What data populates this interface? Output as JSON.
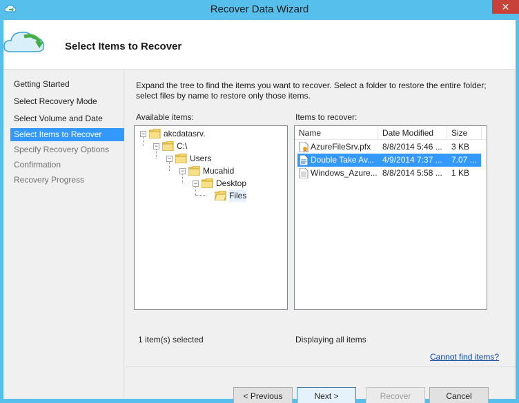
{
  "window": {
    "title": "Recover Data Wizard",
    "close_glyph": "✕",
    "colors": {
      "frame": "#56bfeb",
      "close": "#c7433a",
      "selection": "#3399ff"
    }
  },
  "header": {
    "title": "Select Items to Recover",
    "icon": "cloud-recover-icon"
  },
  "nav": {
    "items": [
      {
        "label": "Getting Started",
        "state": "done"
      },
      {
        "label": "Select Recovery Mode",
        "state": "done"
      },
      {
        "label": "Select Volume and Date",
        "state": "done"
      },
      {
        "label": "Select Items to Recover",
        "state": "active"
      },
      {
        "label": "Specify Recovery Options",
        "state": "pending"
      },
      {
        "label": "Confirmation",
        "state": "pending"
      },
      {
        "label": "Recovery Progress",
        "state": "pending"
      }
    ]
  },
  "main": {
    "instructions": "Expand the tree to find the items you want to recover. Select a folder to restore the entire folder; select files by name to restore only those items.",
    "available_label": "Available items:",
    "recover_label": "Items to recover:",
    "tree": [
      {
        "label": "akcdatasrv.",
        "expander": "−",
        "icon": "folder-icon"
      },
      {
        "label": "C:\\",
        "expander": "−",
        "icon": "folder-icon"
      },
      {
        "label": "Users",
        "expander": "−",
        "icon": "folder-icon"
      },
      {
        "label": "Mucahid",
        "expander": "−",
        "icon": "folder-icon"
      },
      {
        "label": "Desktop",
        "expander": "−",
        "icon": "folder-icon"
      },
      {
        "label": "Files",
        "expander": "",
        "icon": "open-folder-icon"
      }
    ],
    "list": {
      "columns": [
        "Name",
        "Date Modified",
        "Size"
      ],
      "rows": [
        {
          "name": "AzureFileSrv.pfx",
          "date": "8/8/2014 5:46 ...",
          "size": "3 KB",
          "icon": "certificate-file-icon",
          "selected": false
        },
        {
          "name": "Double Take Av...",
          "date": "4/9/2014 7:37 ...",
          "size": "7.07 ...",
          "icon": "document-file-icon",
          "selected": true
        },
        {
          "name": "Windows_Azure...",
          "date": "8/8/2014 5:58 ...",
          "size": "1 KB",
          "icon": "text-file-icon",
          "selected": false
        }
      ]
    },
    "selection_status": "1 item(s) selected",
    "display_status": "Displaying all items",
    "cannot_find_link": "Cannot find items?"
  },
  "footer": {
    "previous": "< Previous",
    "next": "Next >",
    "recover": "Recover",
    "cancel": "Cancel"
  }
}
